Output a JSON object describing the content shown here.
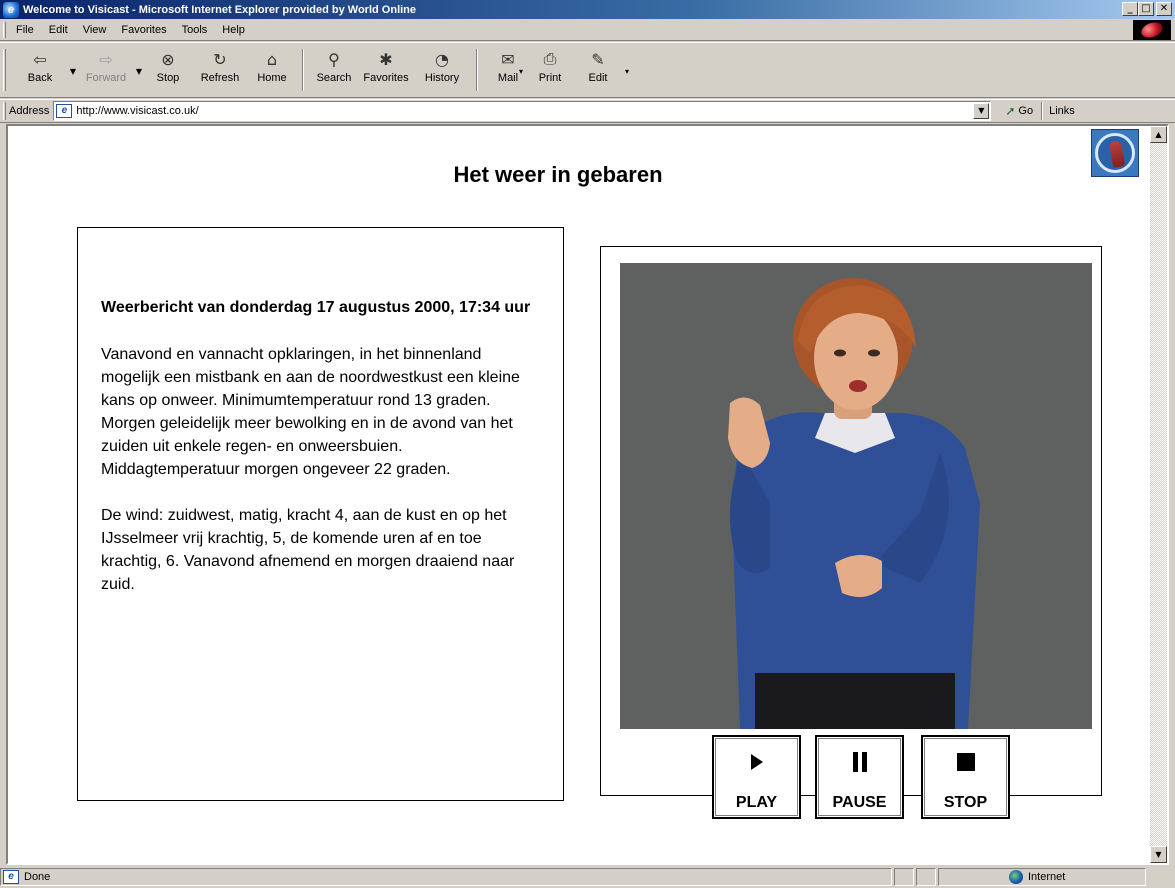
{
  "window": {
    "title": "Welcome to Visicast - Microsoft Internet Explorer provided by World Online",
    "controls": {
      "minimize": "_",
      "maximize": "□",
      "close": "✕"
    }
  },
  "menu": [
    {
      "label": "File",
      "icon": ""
    },
    {
      "label": "Edit"
    },
    {
      "label": "View"
    },
    {
      "label": "Favorites"
    },
    {
      "label": "Tools"
    },
    {
      "label": "Help"
    }
  ],
  "toolbar": {
    "back": "Back",
    "forward": "Forward",
    "stop": "Stop",
    "refresh": "Refresh",
    "home": "Home",
    "search": "Search",
    "favorites": "Favorites",
    "history": "History",
    "mail": "Mail",
    "print": "Print",
    "edit": "Edit"
  },
  "address": {
    "label": "Address",
    "url": "http://www.visicast.co.uk/",
    "go": "Go",
    "links": "Links"
  },
  "page": {
    "heading": "Het weer in gebaren",
    "report_heading": "Weerbericht van donderdag 17 augustus 2000, 17:34 uur",
    "paragraph_1": "Vanavond en vannacht opklaringen, in het binnenland mogelijk een mistbank en aan de noordwestkust een kleine kans op onweer. Minimumtemperatuur rond 13 graden. Morgen geleidelijk meer bewolking en in de avond van het zuiden uit enkele regen- en onweersbuien. Middagtemperatuur morgen ongeveer 22 graden.",
    "paragraph_2": "De wind: zuidwest, matig, kracht 4, aan de kust en op het IJsselmeer vrij krachtig, 5, de komende uren af en toe krachtig, 6. Vanavond afnemend en morgen draaiend naar zuid.",
    "controls": {
      "play": "PLAY",
      "pause": "PAUSE",
      "stop": "STOP"
    }
  },
  "status": {
    "text": "Done",
    "zone": "Internet"
  },
  "colors": {
    "titlebar_start": "#0a246a",
    "titlebar_end": "#a6caf0",
    "chrome": "#d4d0c8",
    "video_bg": "#5f6161",
    "avatar_sweater": "#2f4f96"
  }
}
